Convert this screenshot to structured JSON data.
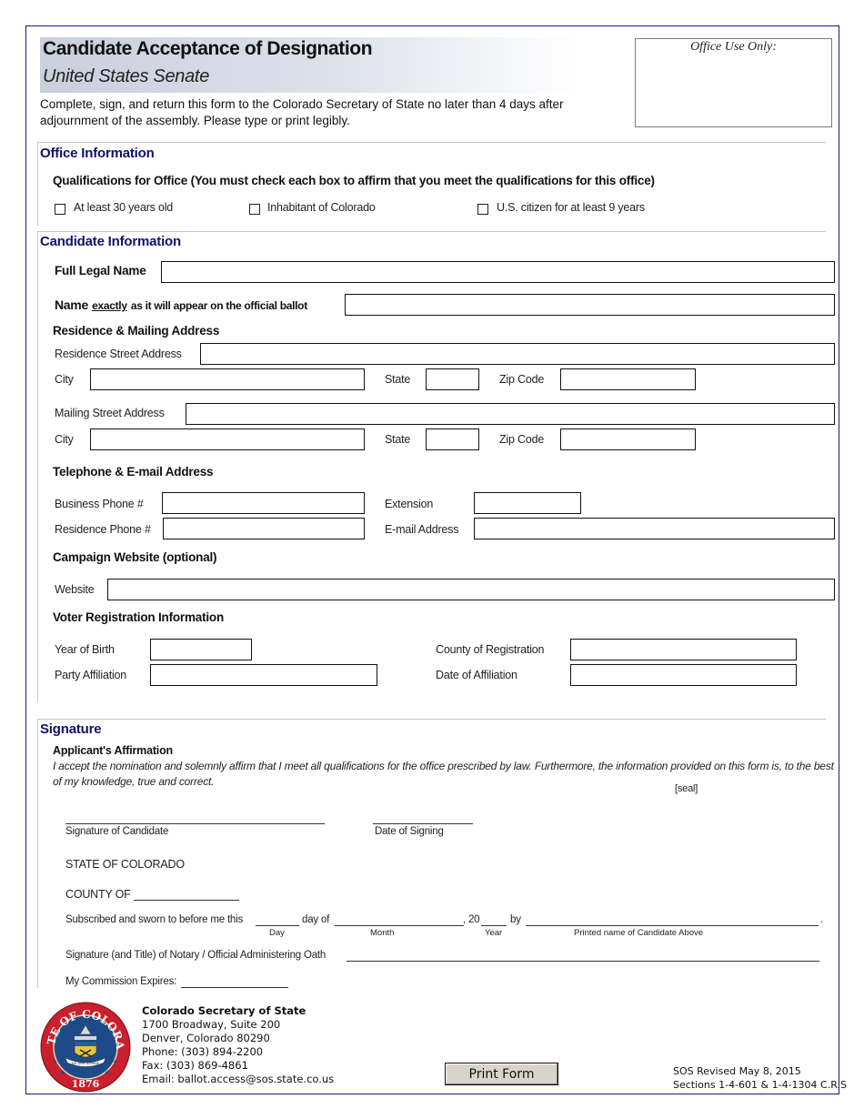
{
  "header": {
    "title": "Candidate Acceptance of Designation",
    "subtitle": "United States Senate",
    "instructions": "Complete, sign, and return this form to the Colorado Secretary of State no later than 4 days after adjournment of the assembly. Please type or print legibly.",
    "office_use_label": "Office Use Only:"
  },
  "office_information": {
    "section_title": "Office Information",
    "qualifications_heading": "Qualifications for Office (You must check each box to affirm that you meet the qualifications for this office)",
    "checkboxes": [
      {
        "label": "At least 30 years old",
        "checked": false
      },
      {
        "label": "Inhabitant of Colorado",
        "checked": false
      },
      {
        "label": "U.S. citizen for at least 9 years",
        "checked": false
      }
    ]
  },
  "candidate_information": {
    "section_title": "Candidate Information",
    "full_legal_name_label": "Full Legal Name",
    "ballot_name_label_pre": "Name",
    "ballot_name_label_emph": "exactly",
    "ballot_name_label_post": "as it will appear on the official ballot",
    "address_heading": "Residence & Mailing Address",
    "residence_street_label": "Residence Street Address",
    "mailing_street_label": "Mailing Street Address",
    "city_label": "City",
    "state_label": "State",
    "zip_label": "Zip Code",
    "phone_heading": "Telephone & E-mail Address",
    "business_phone_label": "Business Phone #",
    "extension_label": "Extension",
    "residence_phone_label": "Residence Phone #",
    "email_label": "E-mail Address",
    "website_heading": "Campaign Website (optional)",
    "website_label": "Website",
    "voter_heading": "Voter Registration Information",
    "year_of_birth_label": "Year of Birth",
    "county_label": "County of Registration",
    "party_label": "Party Affiliation",
    "date_affiliation_label": "Date of Affiliation",
    "values": {
      "full_legal_name": "",
      "ballot_name": "",
      "residence_street": "",
      "residence_city": "",
      "residence_state": "",
      "residence_zip": "",
      "mailing_street": "",
      "mailing_city": "",
      "mailing_state": "",
      "mailing_zip": "",
      "business_phone": "",
      "extension": "",
      "residence_phone": "",
      "email": "",
      "website": "",
      "year_of_birth": "",
      "county": "",
      "party": "",
      "date_affiliation": ""
    }
  },
  "signature": {
    "section_title": "Signature",
    "affirmation_heading": "Applicant's Affirmation",
    "affirmation_text": "I accept the nomination and solemnly affirm that I meet all qualifications for the office prescribed by law. Furthermore, the information provided on this form is, to the best of my knowledge, true and correct.",
    "seal_label": "[seal]",
    "signature_caption": "Signature of Candidate",
    "date_caption": "Date of Signing",
    "state_line": "STATE OF COLORADO",
    "county_line": "COUNTY OF",
    "sworn_pre": "Subscribed and sworn to before me this",
    "sworn_dayof": "day of",
    "sworn_year": ", 20",
    "sworn_by": "by",
    "sworn_end": ".",
    "day_caption": "Day",
    "month_caption": "Month",
    "year_caption": "Year",
    "printed_name_caption": "Printed name of Candidate Above",
    "notary_line": "Signature (and Title) of Notary / Official Administering Oath",
    "commission_line": "My Commission Expires:"
  },
  "footer": {
    "org": "Colorado Secretary of State",
    "address1": "1700 Broadway, Suite 200",
    "address2": "Denver, Colorado 80290",
    "phone": "Phone: (303) 894-2200",
    "fax": "Fax: (303) 869-4861",
    "email": "Email: ballot.access@sos.state.co.us",
    "print_button": "Print Form",
    "revised": "SOS Revised May 8, 2015",
    "sections": "Sections 1-4-601 & 1-4-1304 C.R.S",
    "seal_text_top": "STATE OF COLORADO",
    "seal_year": "1876",
    "seal_motto": "NIL SINE NUMINE"
  },
  "colors": {
    "section_title": "#10106e",
    "page_border": "#1a1a7a",
    "seal_red": "#c8202c",
    "seal_blue": "#1f4a8a",
    "button_bg": "#d8d4cc"
  }
}
